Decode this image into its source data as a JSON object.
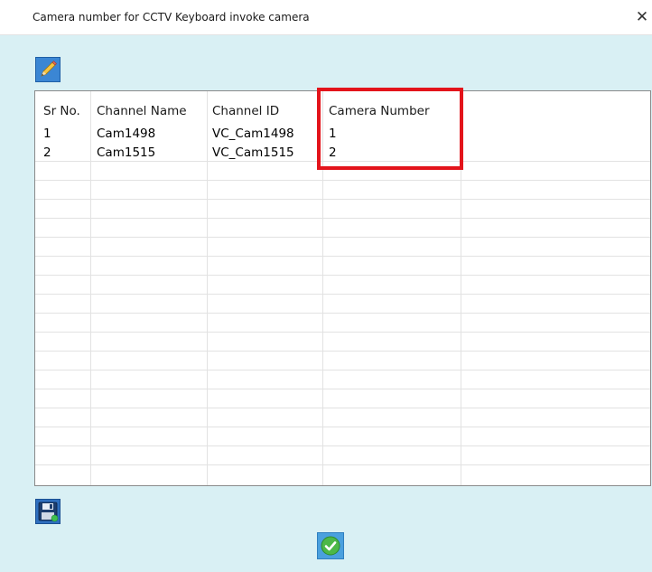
{
  "window": {
    "title": "Camera number for CCTV Keyboard invoke camera",
    "close_label": "✕"
  },
  "toolbar": {
    "edit_icon": "pencil-icon",
    "save_icon": "floppy-disk-icon",
    "ok_icon": "checkmark-icon"
  },
  "table": {
    "columns": [
      "Sr No.",
      "Channel Name",
      "Channel ID",
      "Camera Number"
    ],
    "rows": [
      {
        "sr": "1",
        "channel_name": "Cam1498",
        "channel_id": "VC_Cam1498",
        "camera_number": "1"
      },
      {
        "sr": "2",
        "channel_name": "Cam1515",
        "channel_id": "VC_Cam1515",
        "camera_number": "2"
      }
    ]
  },
  "colors": {
    "background": "#d9f0f4",
    "highlight_border": "#e3141b"
  }
}
